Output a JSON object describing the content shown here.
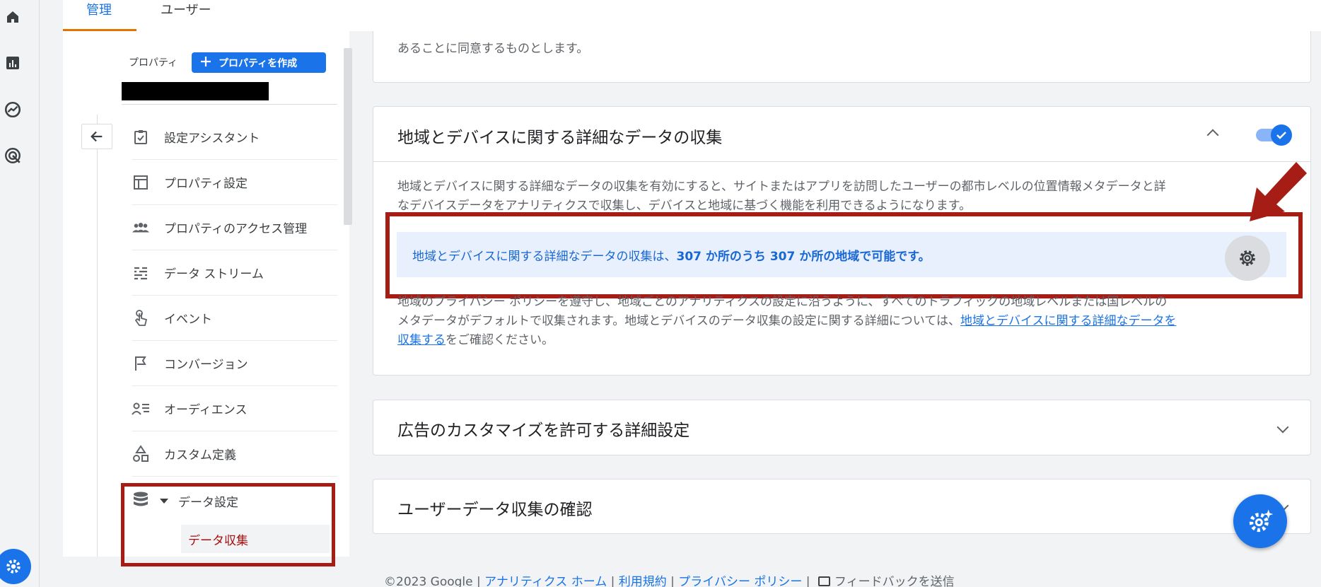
{
  "tabs": [
    {
      "label": "管理",
      "active": true
    },
    {
      "label": "ユーザー",
      "active": false
    }
  ],
  "nav": {
    "property_label": "プロパティ",
    "create_property": "プロパティを作成",
    "items": [
      {
        "label": "設定アシスタント",
        "icon": "checklist-icon"
      },
      {
        "label": "プロパティ設定",
        "icon": "layout-icon"
      },
      {
        "label": "プロパティのアクセス管理",
        "icon": "people-icon"
      },
      {
        "label": "データ ストリーム",
        "icon": "streams-icon"
      },
      {
        "label": "イベント",
        "icon": "touch-icon"
      },
      {
        "label": "コンバージョン",
        "icon": "flag-icon"
      },
      {
        "label": "オーディエンス",
        "icon": "audience-icon"
      },
      {
        "label": "カスタム定義",
        "icon": "shapes-icon"
      },
      {
        "label": "データ設定",
        "icon": "database-icon"
      }
    ],
    "subitem": "データ収集"
  },
  "main": {
    "top_snippet": "あることに同意するものとします。",
    "geo_card": {
      "title": "地域とデバイスに関する詳細なデータの収集",
      "toggle_on": true,
      "description_line1": "地域とデバイスに関する詳細なデータの収集を有効にすると、サイトまたはアプリを訪問したユーザーの都市レベルの位置情報メタデータと詳",
      "description_line2": "なデバイスデータをアナリティクスで収集し、デバイスと地域に基づく機能を利用できるようになります。",
      "banner_prefix": "地域とデバイスに関する詳細なデータの収集は、",
      "banner_bold": "307 か所のうち 307 か所の地域で可能です。",
      "policy_line1": "地域のプライバシー ポリシーを遵守し、地域ごとのアナリティクスの設定に沿うように、すべてのトラフィックの地域レベルまたは国レベルの",
      "policy_line2": "メタデータがデフォルトで収集されます。地域とデバイスのデータ収集の設定に関する詳細については、",
      "policy_link_a": "地域とデバイスに関する詳細なデータを",
      "policy_link_b": "収集する",
      "policy_suffix": "をご確認ください。"
    },
    "ads_card_title": "広告のカスタマイズを許可する詳細設定",
    "user_data_card_title": "ユーザーデータ収集の確認"
  },
  "footer": {
    "copyright": "©2023 Google",
    "sep": " | ",
    "home": "アナリティクス ホーム",
    "terms": "利用規約",
    "privacy": "プライバシー ポリシー",
    "feedback": "フィードバックを送信"
  },
  "colors": {
    "accent": "#1a73e8",
    "annotation_red": "#a51d14",
    "tab_underline": "#e37400"
  }
}
